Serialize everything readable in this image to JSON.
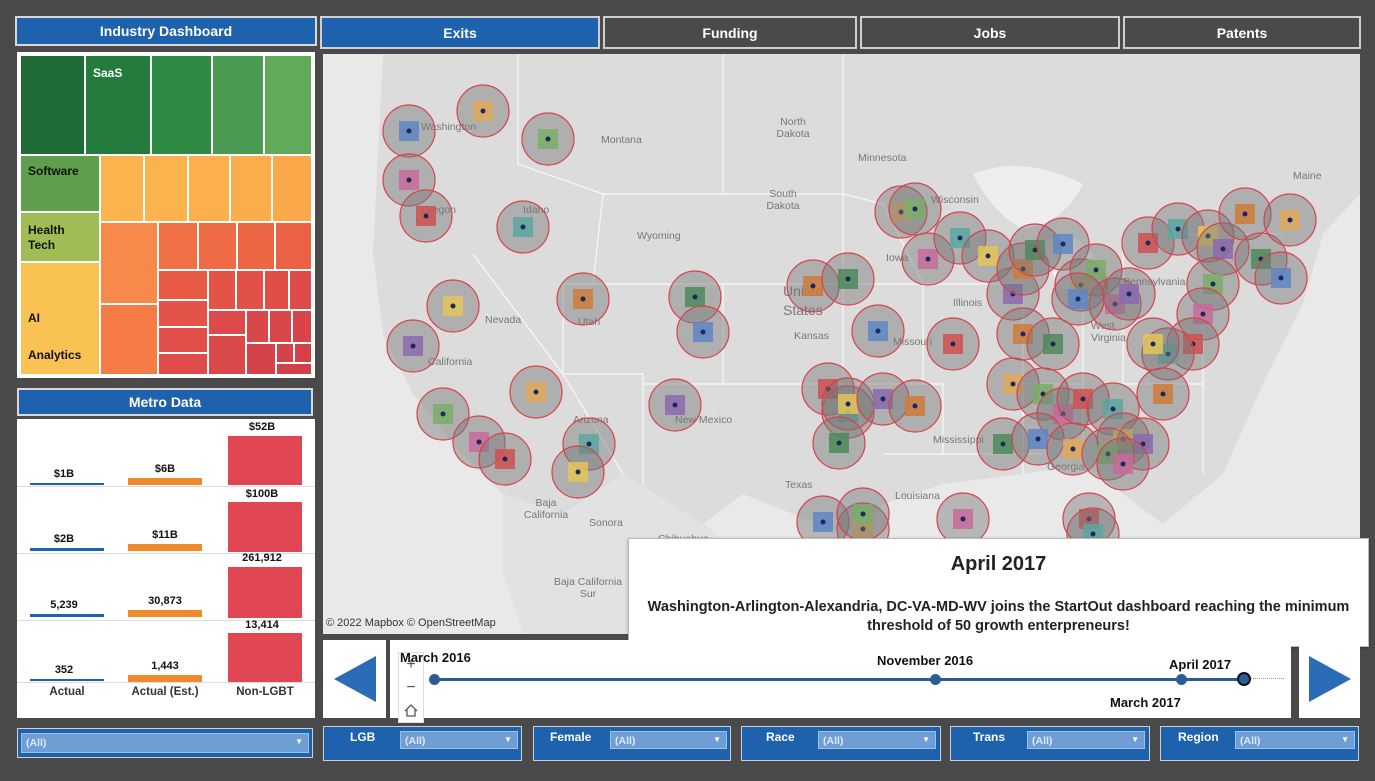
{
  "tabs": [
    {
      "label": "Exits",
      "active": true
    },
    {
      "label": "Funding",
      "active": false
    },
    {
      "label": "Jobs",
      "active": false
    },
    {
      "label": "Patents",
      "active": false
    }
  ],
  "industry": {
    "title": "Industry Dashboard",
    "labels": [
      "SaaS",
      "Software",
      "Health Tech",
      "AI",
      "Analytics"
    ]
  },
  "metro": {
    "title": "Metro Data",
    "rows": [
      {
        "actual": "$1B",
        "actual_est": "$6B",
        "non_lgbt": "$52B"
      },
      {
        "actual": "$2B",
        "actual_est": "$11B",
        "non_lgbt": "$100B"
      },
      {
        "actual": "5,239",
        "actual_est": "30,873",
        "non_lgbt": "261,912"
      },
      {
        "actual": "352",
        "actual_est": "1,443",
        "non_lgbt": "13,414"
      }
    ],
    "columns": [
      "Actual",
      "Actual (Est.)",
      "Non-LGBT"
    ],
    "colors": {
      "actual": "#1e62ad",
      "actual_est": "#ef8a2e",
      "non_lgbt": "#e04752"
    }
  },
  "map": {
    "labels": [
      "North Dakota",
      "Montana",
      "Minnesota",
      "Wisconsin",
      "South Dakota",
      "Wyoming",
      "Iowa",
      "Nevada",
      "Utah",
      "United States",
      "Kansas",
      "Missouri",
      "Illinois",
      "California",
      "Arizona",
      "New Mexico",
      "Texas",
      "Louisiana",
      "Mississippi",
      "Georgia",
      "Baja California",
      "Sonora",
      "Chihuahua",
      "Baja California Sur",
      "West Virginia",
      "Pennsylvania",
      "Maine",
      "Idaho",
      "Oregon",
      "Washington"
    ],
    "copyright": "© 2022 Mapbox  © OpenStreetMap"
  },
  "popup": {
    "title": "April 2017",
    "description": "Washington-Arlington-Alexandria, DC-VA-MD-WV joins the StartOut dashboard reaching the minimum threshold of 50 growth enterpreneurs!"
  },
  "timeline": {
    "labels": [
      "March 2016",
      "November 2016",
      "April 2017",
      "March 2017"
    ]
  },
  "filters": [
    {
      "label": "",
      "value": "(All)"
    },
    {
      "label": "LGB",
      "value": "(All)"
    },
    {
      "label": "Female",
      "value": "(All)"
    },
    {
      "label": "Race",
      "value": "(All)"
    },
    {
      "label": "Trans",
      "value": "(All)"
    },
    {
      "label": "Region",
      "value": "(All)"
    }
  ]
}
